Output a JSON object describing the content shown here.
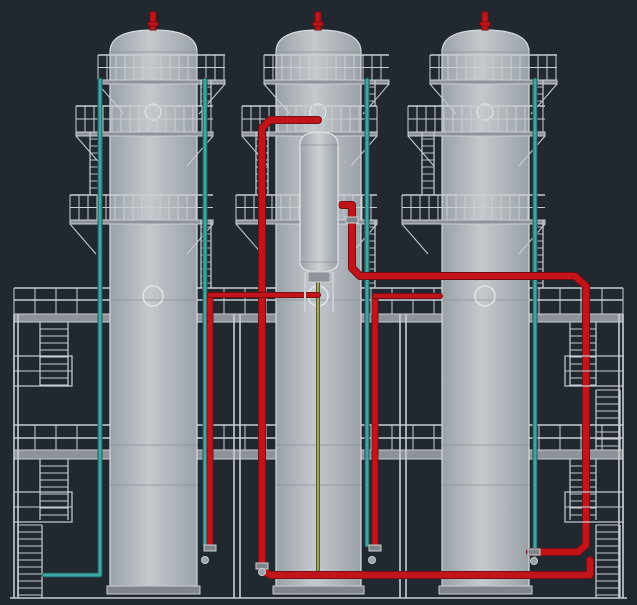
{
  "drawing": {
    "background_color": "#212830",
    "vessel_fill_color": "#b9bfc4",
    "vessel_shade_color": "#9aa1a7",
    "steel_color": "#c9ced2",
    "pipe_red_color": "#c2151b",
    "pipe_red_dark_color": "#7a0d10",
    "pipe_cyan_color": "#3fa7a3",
    "pipe_olive_color": "#a3a35a",
    "vessel_count": 3,
    "receiver_drum_count": 1
  }
}
